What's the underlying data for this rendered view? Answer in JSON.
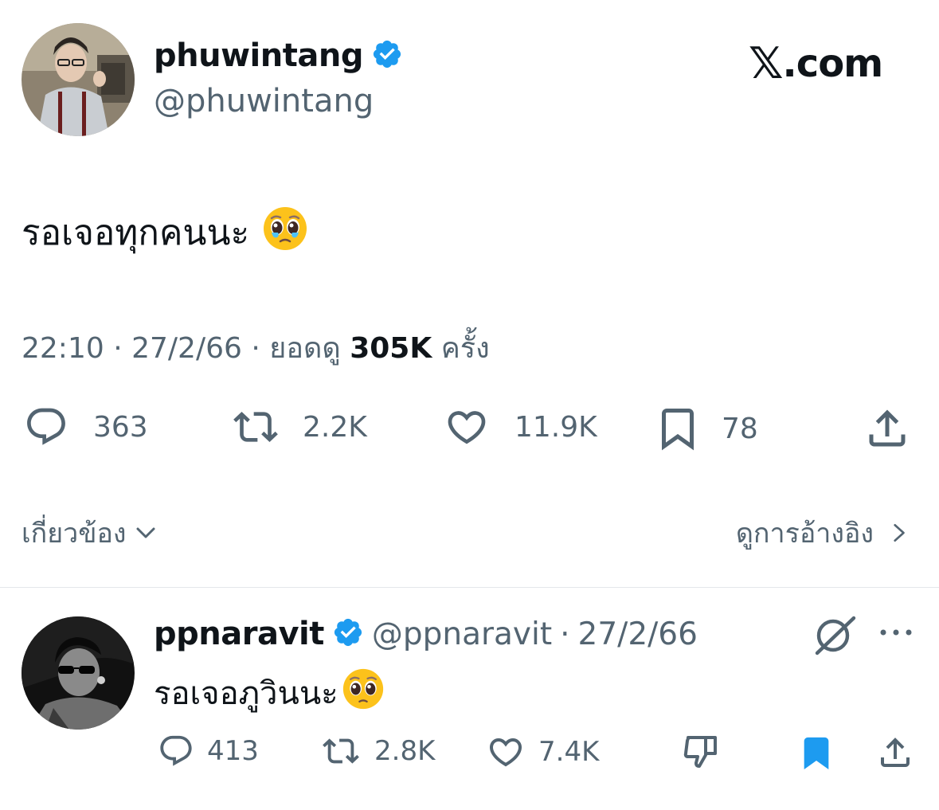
{
  "main_tweet": {
    "display_name": "phuwintang",
    "handle": "@phuwintang",
    "text": "รอเจอทุกคนนะ",
    "emoji": "pleading-face-with-tears-emoji",
    "time": "22:10",
    "separator": "·",
    "date": "27/2/66",
    "views_prefix": "ยอดดู",
    "views_count": "305K",
    "views_suffix": "ครั้ง",
    "replies": "363",
    "reposts": "2.2K",
    "likes": "11.9K",
    "bookmarks": "78"
  },
  "brand": {
    "logo_letter": "𝕏",
    "domain": ".com"
  },
  "related_label": "เกี่ยวข้อง",
  "view_quotes_label": "ดูการอ้างอิง",
  "reply_tweet": {
    "display_name": "ppnaravit",
    "handle": "@ppnaravit",
    "separator": "·",
    "date": "27/2/66",
    "text": "รอเจอภูวินนะ",
    "emoji": "pleading-face-emoji",
    "replies": "413",
    "reposts": "2.8K",
    "likes": "7.4K"
  },
  "colors": {
    "text_primary": "#0f1419",
    "text_secondary": "#536471",
    "verified_blue": "#1d9bf0",
    "bookmark_active": "#1d9bf0",
    "divider": "#e4e7ea"
  }
}
